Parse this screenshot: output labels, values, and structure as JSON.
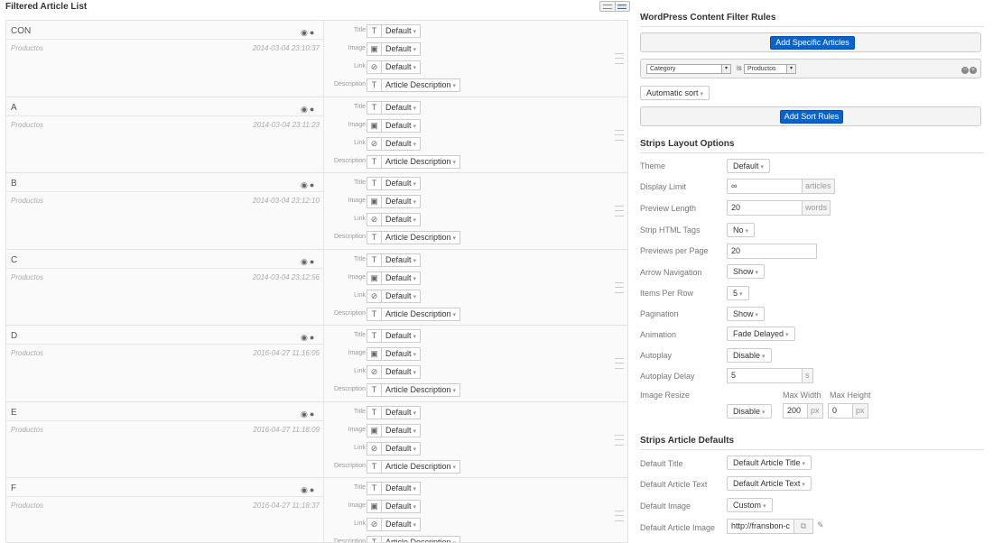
{
  "left_panel": {
    "title": "Filtered Article List",
    "field_labels": [
      "Title",
      "Image",
      "Link",
      "Description"
    ],
    "field_icons": [
      "text-icon",
      "image-icon",
      "link-icon",
      "text-icon"
    ],
    "field_values": [
      "Default",
      "Default",
      "Default",
      "Article Description"
    ],
    "articles": [
      {
        "title": "CON",
        "category": "Productos",
        "date": "2014-03-04 23:10:37"
      },
      {
        "title": "A",
        "category": "Productos",
        "date": "2014-03-04 23:11:23"
      },
      {
        "title": "B",
        "category": "Productos",
        "date": "2014-03-04 23:12:10"
      },
      {
        "title": "C",
        "category": "Productos",
        "date": "2014-03-04 23:12:56"
      },
      {
        "title": "D",
        "category": "Productos",
        "date": "2016-04-27 11:16:05"
      },
      {
        "title": "E",
        "category": "Productos",
        "date": "2016-04-27 11:18:09"
      },
      {
        "title": "F",
        "category": "Productos",
        "date": "2016-04-27 11:18:37"
      }
    ]
  },
  "filter_rules": {
    "title": "WordPress Content Filter Rules",
    "add_articles_button": "Add Specific Articles",
    "rule_field": "Category",
    "rule_operator": "is",
    "rule_value": "Productos",
    "sort_button": "Automatic sort",
    "add_sort_button": "Add Sort Rules"
  },
  "layout_options": {
    "title": "Strips Layout Options",
    "theme_label": "Theme",
    "theme_value": "Default",
    "display_limit_label": "Display Limit",
    "display_limit_value": "∞",
    "display_limit_unit": "articles",
    "preview_length_label": "Preview Length",
    "preview_length_value": "20",
    "preview_length_unit": "words",
    "strip_html_label": "Strip HTML Tags",
    "strip_html_value": "No",
    "previews_per_page_label": "Previews per Page",
    "previews_per_page_value": "20",
    "arrow_nav_label": "Arrow Navigation",
    "arrow_nav_value": "Show",
    "items_per_row_label": "Items Per Row",
    "items_per_row_value": "5",
    "pagination_label": "Pagination",
    "pagination_value": "Show",
    "animation_label": "Animation",
    "animation_value": "Fade Delayed",
    "autoplay_label": "Autoplay",
    "autoplay_value": "Disable",
    "autoplay_delay_label": "Autoplay Delay",
    "autoplay_delay_value": "5",
    "autoplay_delay_unit": "s",
    "image_resize_label": "Image Resize",
    "image_resize_value": "Disable",
    "max_width_label": "Max Width",
    "max_width_value": "200",
    "max_width_unit": "px",
    "max_height_label": "Max Height",
    "max_height_value": "0",
    "max_height_unit": "px"
  },
  "article_defaults": {
    "title": "Strips Article Defaults",
    "default_title_label": "Default Title",
    "default_title_value": "Default Article Title",
    "default_text_label": "Default Article Text",
    "default_text_value": "Default Article Text",
    "default_image_label": "Default Image",
    "default_image_value": "Custom",
    "default_article_image_label": "Default Article Image",
    "default_article_image_value": "http://fransbon-c"
  }
}
